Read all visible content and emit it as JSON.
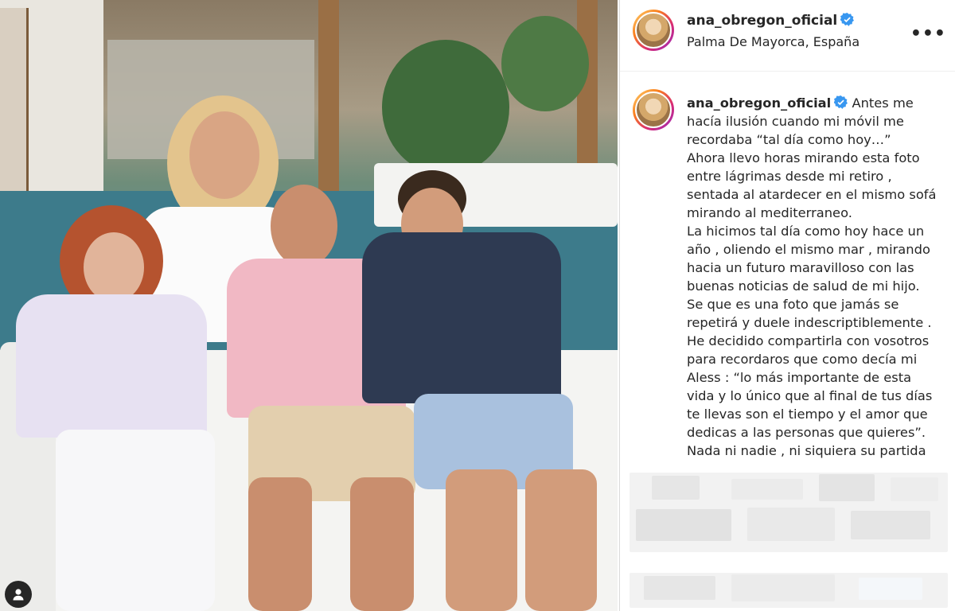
{
  "post": {
    "username": "ana_obregon_oficial",
    "location": "Palma De Mayorca, España",
    "more_label": "•••",
    "caption_lines": [
      "Antes me",
      "hacía ilusión cuando mi móvil me",
      "recordaba “tal día como hoy…”",
      "Ahora llevo horas mirando esta foto",
      "entre lágrimas desde mi retiro ,",
      "sentada al atardecer en el mismo sofá",
      "mirando al mediterraneo.",
      "La hicimos tal día como hoy hace un",
      "año , oliendo el mismo mar , mirando",
      "hacia un futuro maravilloso con las",
      "buenas noticias de salud de mi hijo.",
      "Se que es una foto que jamás se",
      "repetirá y duele indescriptiblemente .",
      "He decidido compartirla con vosotros",
      "para recordaros que como decía mi",
      "Aless : “lo más importante de esta",
      "vida y lo único que al final de tus días",
      "te llevas son el tiempo y el amor que",
      "dedicas a las personas que quieres”.",
      "Nada ni nadie , ni siquiera su partida"
    ]
  },
  "icons": {
    "verified": "verified-badge-icon",
    "more": "more-options-icon",
    "user_tag": "user-tag-icon"
  },
  "colors": {
    "verified_blue": "#3897f0",
    "text": "#262626",
    "story_ring_start": "#feda75",
    "story_ring_end": "#962fbf"
  }
}
